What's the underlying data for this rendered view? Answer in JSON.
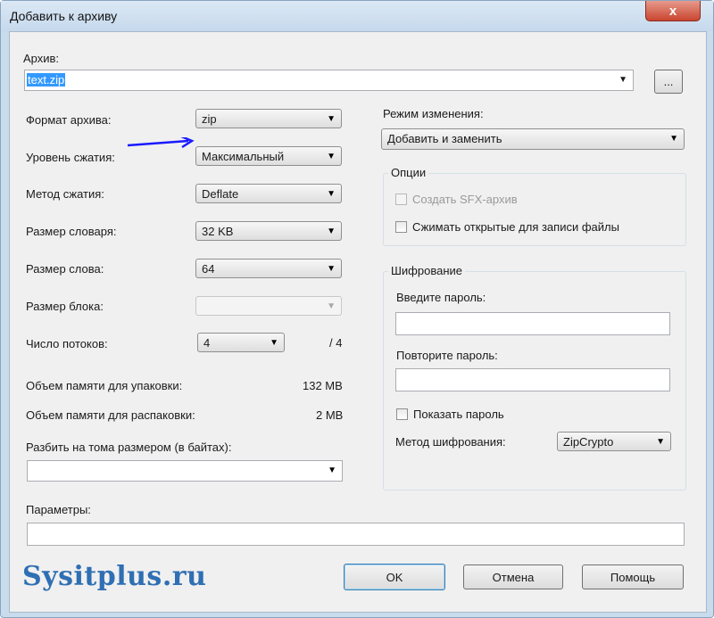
{
  "window": {
    "title": "Добавить к архиву",
    "close_symbol": "x"
  },
  "archive": {
    "label": "Архив:",
    "value": "text.zip",
    "browse_label": "..."
  },
  "left": {
    "format": {
      "label": "Формат архива:",
      "value": "zip"
    },
    "level": {
      "label": "Уровень сжатия:",
      "value": "Максимальный"
    },
    "method": {
      "label": "Метод сжатия:",
      "value": "Deflate"
    },
    "dict": {
      "label": "Размер словаря:",
      "value": "32 KB"
    },
    "word": {
      "label": "Размер слова:",
      "value": "64"
    },
    "block": {
      "label": "Размер блока:",
      "value": ""
    },
    "threads": {
      "label": "Число потоков:",
      "value": "4",
      "max": "/ 4"
    },
    "mem_pack": {
      "label": "Объем памяти для упаковки:",
      "value": "132 MB"
    },
    "mem_unpack": {
      "label": "Объем памяти для распаковки:",
      "value": "2 MB"
    },
    "split": {
      "label": "Разбить на тома размером (в байтах):",
      "value": ""
    },
    "params": {
      "label": "Параметры:",
      "value": ""
    }
  },
  "right": {
    "mode": {
      "label": "Режим изменения:",
      "value": "Добавить и заменить"
    },
    "options": {
      "title": "Опции",
      "sfx_label": "Создать SFX-архив",
      "shared_label": "Сжимать открытые для записи файлы"
    },
    "encryption": {
      "title": "Шифрование",
      "password_label": "Введите пароль:",
      "repeat_label": "Повторите пароль:",
      "show_label": "Показать пароль",
      "method_label": "Метод шифрования:",
      "method_value": "ZipCrypto"
    }
  },
  "buttons": {
    "ok": "OK",
    "cancel": "Отмена",
    "help": "Помощь"
  },
  "watermark": "Sysitplus.ru",
  "colors": {
    "accent_arrow": "#1a1aff",
    "selection": "#3399ff",
    "watermark": "#2f6fb3"
  }
}
